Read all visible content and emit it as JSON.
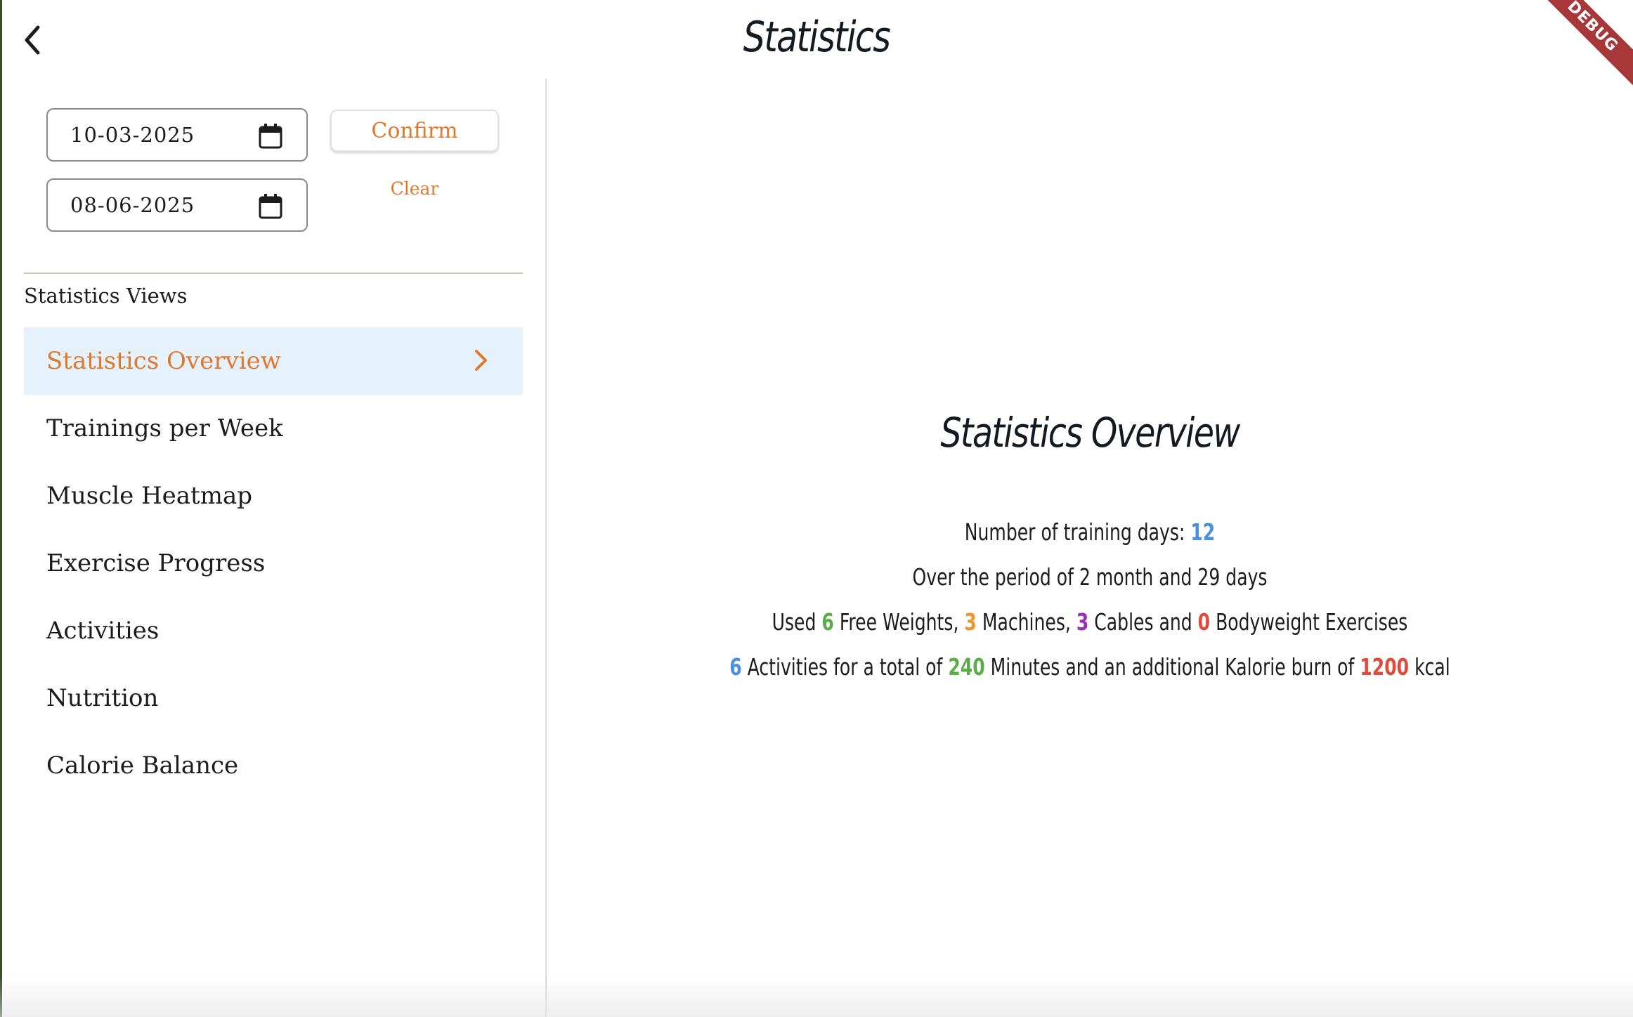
{
  "header": {
    "title": "Statistics",
    "back_icon": "chevron-left-icon",
    "debug_banner": "DEBUG"
  },
  "filters": {
    "start_date": "10-03-2025",
    "end_date": "08-06-2025",
    "calendar_icon": "calendar-icon",
    "confirm_label": "Confirm",
    "clear_label": "Clear",
    "accent_color": "#e0782d"
  },
  "sidebar": {
    "section_label": "Statistics Views",
    "items": [
      {
        "label": "Statistics Overview",
        "active": true
      },
      {
        "label": "Trainings per Week",
        "active": false
      },
      {
        "label": "Muscle Heatmap",
        "active": false
      },
      {
        "label": "Exercise Progress",
        "active": false
      },
      {
        "label": "Activities",
        "active": false
      },
      {
        "label": "Nutrition",
        "active": false
      },
      {
        "label": "Calorie Balance",
        "active": false
      }
    ],
    "active_bg": "#e6f2fb"
  },
  "overview": {
    "title": "Statistics Overview",
    "line1": {
      "prefix": "Number of training days: ",
      "days": "12"
    },
    "line2": {
      "text": "Over the period of 2 month and 29 days"
    },
    "line3": {
      "t1": "Used ",
      "free_weights": "6",
      "t2": " Free Weights, ",
      "machines": "3",
      "t3": " Machines, ",
      "cables": "3",
      "t4": " Cables and ",
      "bodyweight": "0",
      "t5": " Bodyweight Exercises"
    },
    "line4": {
      "activities": "6",
      "t1": " Activities for a total of ",
      "minutes": "240",
      "t2": " Minutes and an additional Kalorie burn of ",
      "kcal": "1200",
      "t3": " kcal"
    },
    "colors": {
      "blue": "#4a90e2",
      "green": "#5cad4a",
      "orange": "#f0952c",
      "purple": "#9b2fb5",
      "red": "#e14b3b"
    }
  }
}
